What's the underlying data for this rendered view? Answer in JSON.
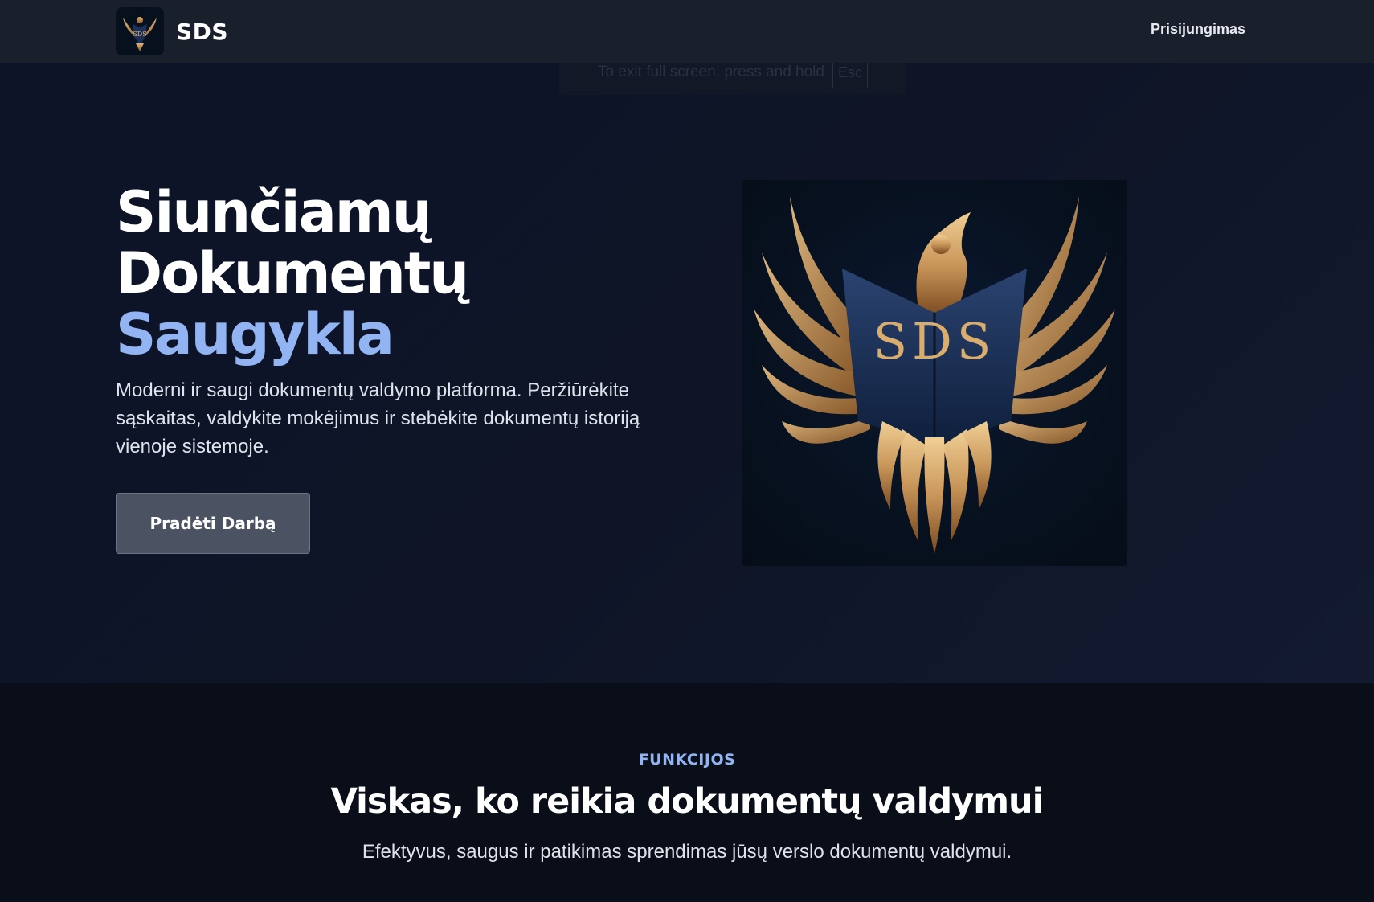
{
  "header": {
    "brand_name": "SDS",
    "logo_icon": "phoenix-logo-icon",
    "login_label": "Prisijungimas"
  },
  "fullscreen_notice": {
    "text": "To exit full screen, press and hold",
    "key": "Esc"
  },
  "hero": {
    "title_line1": "Siunčiamų",
    "title_line2": "Dokumentų",
    "title_accent": "Saugykla",
    "subtitle": "Moderni ir saugi dokumentų valdymo platforma. Peržiūrėkite sąskaitas, valdykite mokėjimus ir stebėkite dokumentų istoriją vienoje sistemoje.",
    "cta_label": "Pradėti Darbą",
    "emblem_text": "SDS",
    "emblem_icon": "phoenix-emblem-icon"
  },
  "features": {
    "eyebrow": "FUNKCIJOS",
    "title": "Viskas, ko reikia dokumentų valdymui",
    "subtitle": "Efektyvus, saugus ir patikimas sprendimas jūsų verslo dokumentų valdymui."
  },
  "colors": {
    "accent": "#93b4f3",
    "header_bg": "#1a1f2c",
    "hero_bg": "#0f1527",
    "button_bg": "#4b5363",
    "gold": "#c9965a"
  }
}
